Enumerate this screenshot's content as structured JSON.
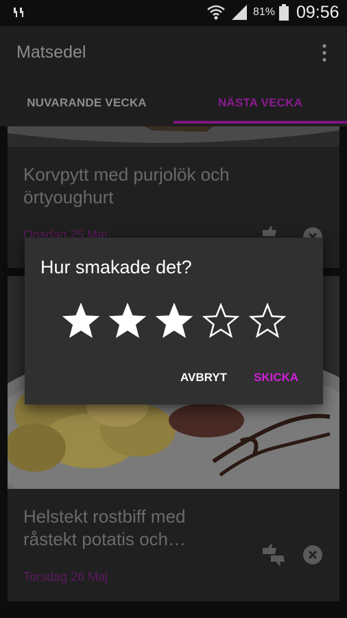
{
  "status_bar": {
    "battery_percent": "81%",
    "time": "09:56",
    "icons": [
      "notification-icon",
      "wifi-icon",
      "signal-icon",
      "battery-icon"
    ]
  },
  "app_bar": {
    "title": "Matsedel",
    "menu_icon": "overflow-menu-icon"
  },
  "tabs": [
    {
      "label": "NUVARANDE VECKA",
      "selected": false
    },
    {
      "label": "NÄSTA VECKA",
      "selected": true
    }
  ],
  "menu_items": [
    {
      "dish": "Korvpytt med purjolök och örtyoughurt",
      "date": "Onsdag 25 Maj"
    },
    {
      "dish": "Helstekt rostbiff med råstekt potatis och…",
      "date": "Torsdag 26 Maj"
    }
  ],
  "rating_dialog": {
    "title": "Hur smakade det?",
    "rating": 3,
    "max_rating": 5,
    "cancel_label": "AVBRYT",
    "submit_label": "SKICKA"
  },
  "colors": {
    "accent": "#d020dc",
    "tab_indicator": "#7d177f",
    "date_text": "#5d1a60",
    "background": "#0d0d0d",
    "card": "#202020",
    "dialog": "#303030"
  }
}
